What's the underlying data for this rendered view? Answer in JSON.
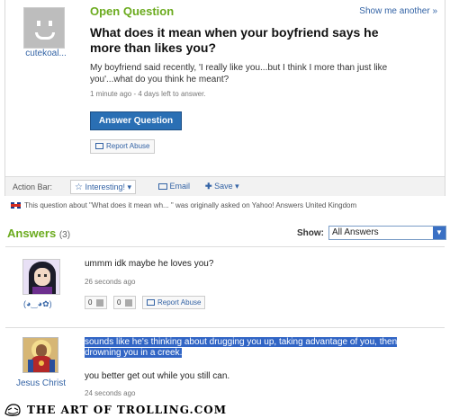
{
  "question": {
    "asker_name": "cutekoal...",
    "label": "Open Question",
    "show_me_link": "Show me another »",
    "title": "What does it mean when your boyfriend says he more than likes you?",
    "body": "My boyfriend said recently, 'I really like you...but I think I more than just like you'...what do you think he meant?",
    "meta": "1 minute ago - 4 days left to answer.",
    "answer_button": "Answer Question",
    "report_button": "Report Abuse"
  },
  "action_bar": {
    "label": "Action Bar:",
    "interesting": "Interesting!",
    "email": "Email",
    "save": "Save"
  },
  "origin_note": "This question about \"What does it mean wh... \" was originally asked on Yahoo! Answers United Kingdom",
  "answers": {
    "title": "Answers",
    "count": "(3)",
    "show_label": "Show:",
    "show_selected": "All Answers",
    "items": [
      {
        "user": "(◕‿◕✿)",
        "text": "ummm idk maybe he loves you?",
        "time": "26 seconds ago",
        "thumbs_up": "0",
        "thumbs_down": "0",
        "report": "Report Abuse"
      },
      {
        "user": "Jesus Christ",
        "text_highlighted": "sounds like he's thinking about drugging you up, taking advantage of you, then drowning you in a creek.",
        "text": "you better get out while you still can.",
        "time": "24 seconds ago"
      }
    ]
  },
  "footer": {
    "text": "THE ART OF TROLLING.COM"
  },
  "colors": {
    "brand_green": "#6bab1e",
    "link_blue": "#3363a5",
    "button_blue": "#2a6fb4",
    "highlight": "#3165c5"
  },
  "icons": [
    "default-avatar-icon",
    "flag-icon",
    "star-icon",
    "email-icon",
    "plus-icon",
    "uk-flag-icon",
    "thumbs-up-icon",
    "thumbs-down-icon",
    "troll-face-icon"
  ]
}
